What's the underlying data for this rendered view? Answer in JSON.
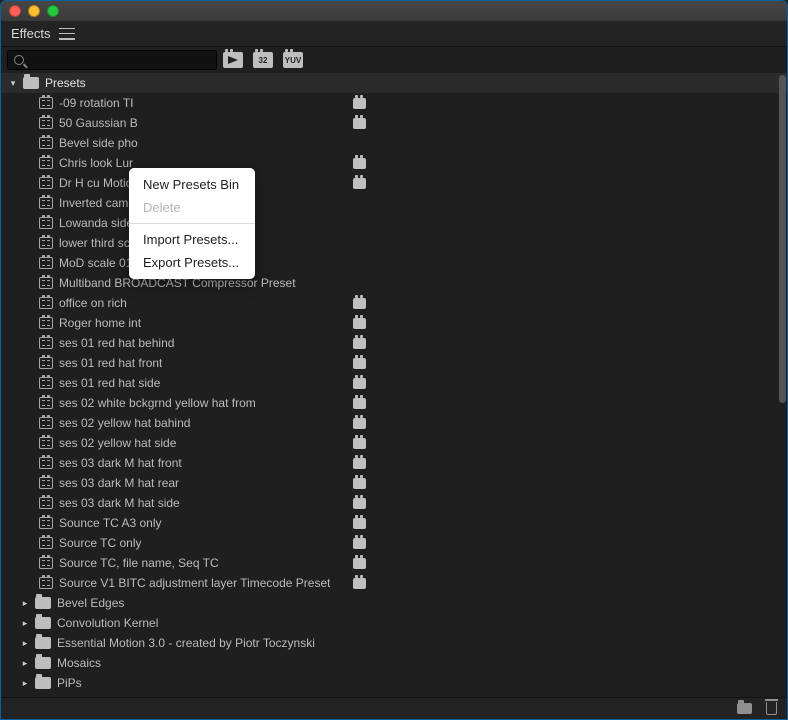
{
  "panel": {
    "title": "Effects"
  },
  "search": {
    "value": "",
    "placeholder": ""
  },
  "tool_icons": [
    "fx",
    "32",
    "YUV"
  ],
  "tree": {
    "root": {
      "label": "Presets",
      "expanded": true
    },
    "items": [
      {
        "label": "-09 rotation TI",
        "badge": true
      },
      {
        "label": "50 Gaussian B",
        "badge": true
      },
      {
        "label": "Bevel side pho",
        "badge": false
      },
      {
        "label": "Chris look Lur",
        "badge": true
      },
      {
        "label": "Dr H cu Motio",
        "badge": true
      },
      {
        "label": "Inverted camera Flip Preset",
        "badge": false
      },
      {
        "label": "Lowanda side angle for pic",
        "badge": false
      },
      {
        "label": "lower third scale lower left",
        "badge": false
      },
      {
        "label": "MoD scale 01",
        "badge": false
      },
      {
        "label": "Multiband  BROADCAST Compressor Preset",
        "badge": false
      },
      {
        "label": "office on rich",
        "badge": true
      },
      {
        "label": "Roger home int",
        "badge": true
      },
      {
        "label": "ses 01 red hat behind",
        "badge": true
      },
      {
        "label": "ses 01 red hat front",
        "badge": true
      },
      {
        "label": "ses 01 red hat side",
        "badge": true
      },
      {
        "label": "ses 02 white bckgrnd yellow hat from",
        "badge": true
      },
      {
        "label": "ses 02 yellow hat bahind",
        "badge": true
      },
      {
        "label": "ses 02 yellow hat side",
        "badge": true
      },
      {
        "label": "ses 03 dark M hat front",
        "badge": true
      },
      {
        "label": "ses 03 dark M hat rear",
        "badge": true
      },
      {
        "label": "ses 03 dark M hat side",
        "badge": true
      },
      {
        "label": "Sounce TC A3 only",
        "badge": true
      },
      {
        "label": "Source TC only",
        "badge": true
      },
      {
        "label": "Source TC, file name, Seq TC",
        "badge": true
      },
      {
        "label": "Source V1 BITC adjustment layer Timecode Preset",
        "badge": true
      }
    ],
    "sub_bins": [
      {
        "label": "Bevel Edges"
      },
      {
        "label": "Convolution Kernel"
      },
      {
        "label": "Essential Motion 3.0 - created by Piotr Toczynski"
      },
      {
        "label": "Mosaics"
      },
      {
        "label": "PiPs"
      }
    ]
  },
  "context_menu": {
    "new_bin": "New Presets Bin",
    "delete": "Delete",
    "import": "Import Presets...",
    "export": "Export Presets..."
  }
}
